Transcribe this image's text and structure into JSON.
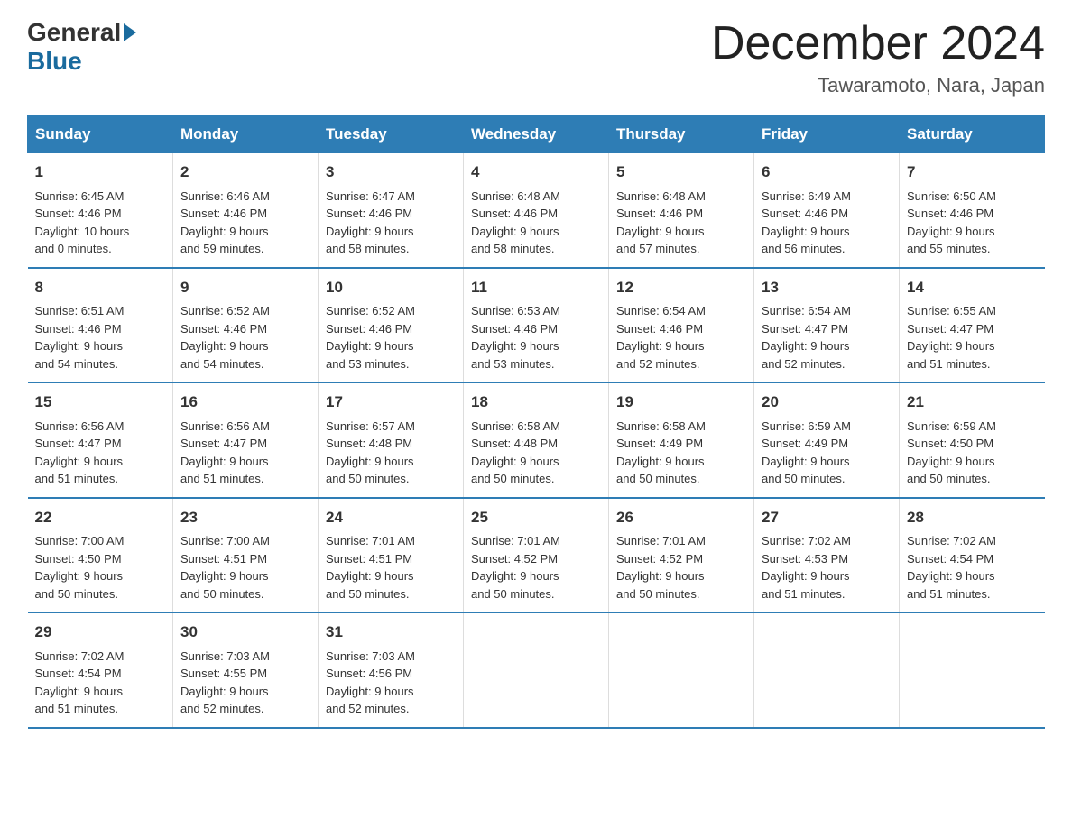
{
  "logo": {
    "general": "General",
    "blue": "Blue"
  },
  "title": "December 2024",
  "location": "Tawaramoto, Nara, Japan",
  "days_header": [
    "Sunday",
    "Monday",
    "Tuesday",
    "Wednesday",
    "Thursday",
    "Friday",
    "Saturday"
  ],
  "weeks": [
    [
      {
        "day": "1",
        "info": "Sunrise: 6:45 AM\nSunset: 4:46 PM\nDaylight: 10 hours\nand 0 minutes."
      },
      {
        "day": "2",
        "info": "Sunrise: 6:46 AM\nSunset: 4:46 PM\nDaylight: 9 hours\nand 59 minutes."
      },
      {
        "day": "3",
        "info": "Sunrise: 6:47 AM\nSunset: 4:46 PM\nDaylight: 9 hours\nand 58 minutes."
      },
      {
        "day": "4",
        "info": "Sunrise: 6:48 AM\nSunset: 4:46 PM\nDaylight: 9 hours\nand 58 minutes."
      },
      {
        "day": "5",
        "info": "Sunrise: 6:48 AM\nSunset: 4:46 PM\nDaylight: 9 hours\nand 57 minutes."
      },
      {
        "day": "6",
        "info": "Sunrise: 6:49 AM\nSunset: 4:46 PM\nDaylight: 9 hours\nand 56 minutes."
      },
      {
        "day": "7",
        "info": "Sunrise: 6:50 AM\nSunset: 4:46 PM\nDaylight: 9 hours\nand 55 minutes."
      }
    ],
    [
      {
        "day": "8",
        "info": "Sunrise: 6:51 AM\nSunset: 4:46 PM\nDaylight: 9 hours\nand 54 minutes."
      },
      {
        "day": "9",
        "info": "Sunrise: 6:52 AM\nSunset: 4:46 PM\nDaylight: 9 hours\nand 54 minutes."
      },
      {
        "day": "10",
        "info": "Sunrise: 6:52 AM\nSunset: 4:46 PM\nDaylight: 9 hours\nand 53 minutes."
      },
      {
        "day": "11",
        "info": "Sunrise: 6:53 AM\nSunset: 4:46 PM\nDaylight: 9 hours\nand 53 minutes."
      },
      {
        "day": "12",
        "info": "Sunrise: 6:54 AM\nSunset: 4:46 PM\nDaylight: 9 hours\nand 52 minutes."
      },
      {
        "day": "13",
        "info": "Sunrise: 6:54 AM\nSunset: 4:47 PM\nDaylight: 9 hours\nand 52 minutes."
      },
      {
        "day": "14",
        "info": "Sunrise: 6:55 AM\nSunset: 4:47 PM\nDaylight: 9 hours\nand 51 minutes."
      }
    ],
    [
      {
        "day": "15",
        "info": "Sunrise: 6:56 AM\nSunset: 4:47 PM\nDaylight: 9 hours\nand 51 minutes."
      },
      {
        "day": "16",
        "info": "Sunrise: 6:56 AM\nSunset: 4:47 PM\nDaylight: 9 hours\nand 51 minutes."
      },
      {
        "day": "17",
        "info": "Sunrise: 6:57 AM\nSunset: 4:48 PM\nDaylight: 9 hours\nand 50 minutes."
      },
      {
        "day": "18",
        "info": "Sunrise: 6:58 AM\nSunset: 4:48 PM\nDaylight: 9 hours\nand 50 minutes."
      },
      {
        "day": "19",
        "info": "Sunrise: 6:58 AM\nSunset: 4:49 PM\nDaylight: 9 hours\nand 50 minutes."
      },
      {
        "day": "20",
        "info": "Sunrise: 6:59 AM\nSunset: 4:49 PM\nDaylight: 9 hours\nand 50 minutes."
      },
      {
        "day": "21",
        "info": "Sunrise: 6:59 AM\nSunset: 4:50 PM\nDaylight: 9 hours\nand 50 minutes."
      }
    ],
    [
      {
        "day": "22",
        "info": "Sunrise: 7:00 AM\nSunset: 4:50 PM\nDaylight: 9 hours\nand 50 minutes."
      },
      {
        "day": "23",
        "info": "Sunrise: 7:00 AM\nSunset: 4:51 PM\nDaylight: 9 hours\nand 50 minutes."
      },
      {
        "day": "24",
        "info": "Sunrise: 7:01 AM\nSunset: 4:51 PM\nDaylight: 9 hours\nand 50 minutes."
      },
      {
        "day": "25",
        "info": "Sunrise: 7:01 AM\nSunset: 4:52 PM\nDaylight: 9 hours\nand 50 minutes."
      },
      {
        "day": "26",
        "info": "Sunrise: 7:01 AM\nSunset: 4:52 PM\nDaylight: 9 hours\nand 50 minutes."
      },
      {
        "day": "27",
        "info": "Sunrise: 7:02 AM\nSunset: 4:53 PM\nDaylight: 9 hours\nand 51 minutes."
      },
      {
        "day": "28",
        "info": "Sunrise: 7:02 AM\nSunset: 4:54 PM\nDaylight: 9 hours\nand 51 minutes."
      }
    ],
    [
      {
        "day": "29",
        "info": "Sunrise: 7:02 AM\nSunset: 4:54 PM\nDaylight: 9 hours\nand 51 minutes."
      },
      {
        "day": "30",
        "info": "Sunrise: 7:03 AM\nSunset: 4:55 PM\nDaylight: 9 hours\nand 52 minutes."
      },
      {
        "day": "31",
        "info": "Sunrise: 7:03 AM\nSunset: 4:56 PM\nDaylight: 9 hours\nand 52 minutes."
      },
      {
        "day": "",
        "info": ""
      },
      {
        "day": "",
        "info": ""
      },
      {
        "day": "",
        "info": ""
      },
      {
        "day": "",
        "info": ""
      }
    ]
  ]
}
